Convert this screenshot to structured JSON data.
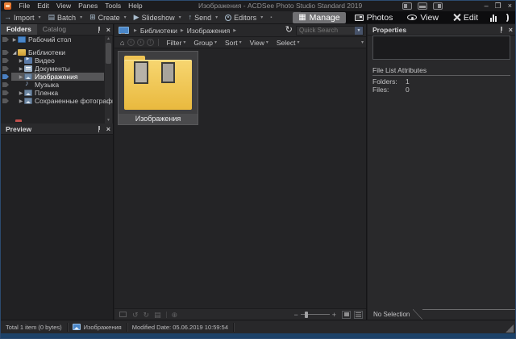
{
  "window": {
    "title": "Изображения - ACDSee Photo Studio Standard 2019",
    "menus": [
      "File",
      "Edit",
      "View",
      "Panes",
      "Tools",
      "Help"
    ],
    "controls": {
      "minimize": "–",
      "maximize": "❐",
      "close": "×"
    }
  },
  "toolbar": {
    "items": [
      {
        "label": "Import"
      },
      {
        "label": "Batch"
      },
      {
        "label": "Create"
      },
      {
        "label": "Slideshow"
      },
      {
        "label": "Send"
      },
      {
        "label": "Editors"
      }
    ]
  },
  "modes": {
    "manage": "Manage",
    "photos": "Photos",
    "view": "View",
    "edit": "Edit",
    "active": "Manage"
  },
  "left_panel": {
    "tabs": {
      "folders": "Folders",
      "catalog": "Catalog"
    },
    "active_tab": "Folders",
    "tree": [
      {
        "label": "Рабочий стол",
        "icon": "desktop-icon",
        "state": "collapsed"
      },
      {
        "label": "Библиотеки",
        "icon": "libraries-icon",
        "state": "expanded"
      },
      {
        "label": "Видео",
        "icon": "video-icon",
        "state": "collapsed"
      },
      {
        "label": "Документы",
        "icon": "documents-icon",
        "state": "collapsed"
      },
      {
        "label": "Изображения",
        "icon": "pictures-icon",
        "state": "collapsed",
        "selected": true
      },
      {
        "label": "Музыка",
        "icon": "music-icon",
        "state": "leaf"
      },
      {
        "label": "Пленка",
        "icon": "pictures-icon",
        "state": "collapsed"
      },
      {
        "label": "Сохраненные фотографии",
        "icon": "pictures-icon",
        "state": "collapsed"
      }
    ],
    "preview_title": "Preview"
  },
  "center": {
    "breadcrumb": {
      "item1": "Библиотеки",
      "item2": "Изображения"
    },
    "search_placeholder": "Quick Search",
    "filter_menus": {
      "filter": "Filter",
      "group": "Group",
      "sort": "Sort",
      "view": "View",
      "select": "Select"
    },
    "tile_label": "Изображения"
  },
  "right_panel": {
    "title": "Properties",
    "section_title": "File List Attributes",
    "rows": [
      {
        "label": "Folders:",
        "value": "1"
      },
      {
        "label": "Files:",
        "value": "0"
      }
    ],
    "selection_tab": "No Selection"
  },
  "status_bar": {
    "total": "Total 1 item  (0 bytes)",
    "location": "Изображения",
    "modified": "Modified Date: 05.06.2019 10:59:54"
  },
  "icons": {
    "app": "acdsee-logo-icon",
    "modes": [
      "grid-icon",
      "photos-icon",
      "eye-icon",
      "edit-x-icon",
      "bar-chart-icon",
      "acdsee-365-icon"
    ],
    "nav": [
      "home-icon",
      "back-icon",
      "forward-icon",
      "up-icon",
      "refresh-icon"
    ]
  },
  "colors": {
    "accent_blue": "#4a86c8",
    "folder_yellow": "#e9b93e",
    "window_border": "#1d4268",
    "selection_gray": "#565658",
    "manage_active": "#707073"
  }
}
